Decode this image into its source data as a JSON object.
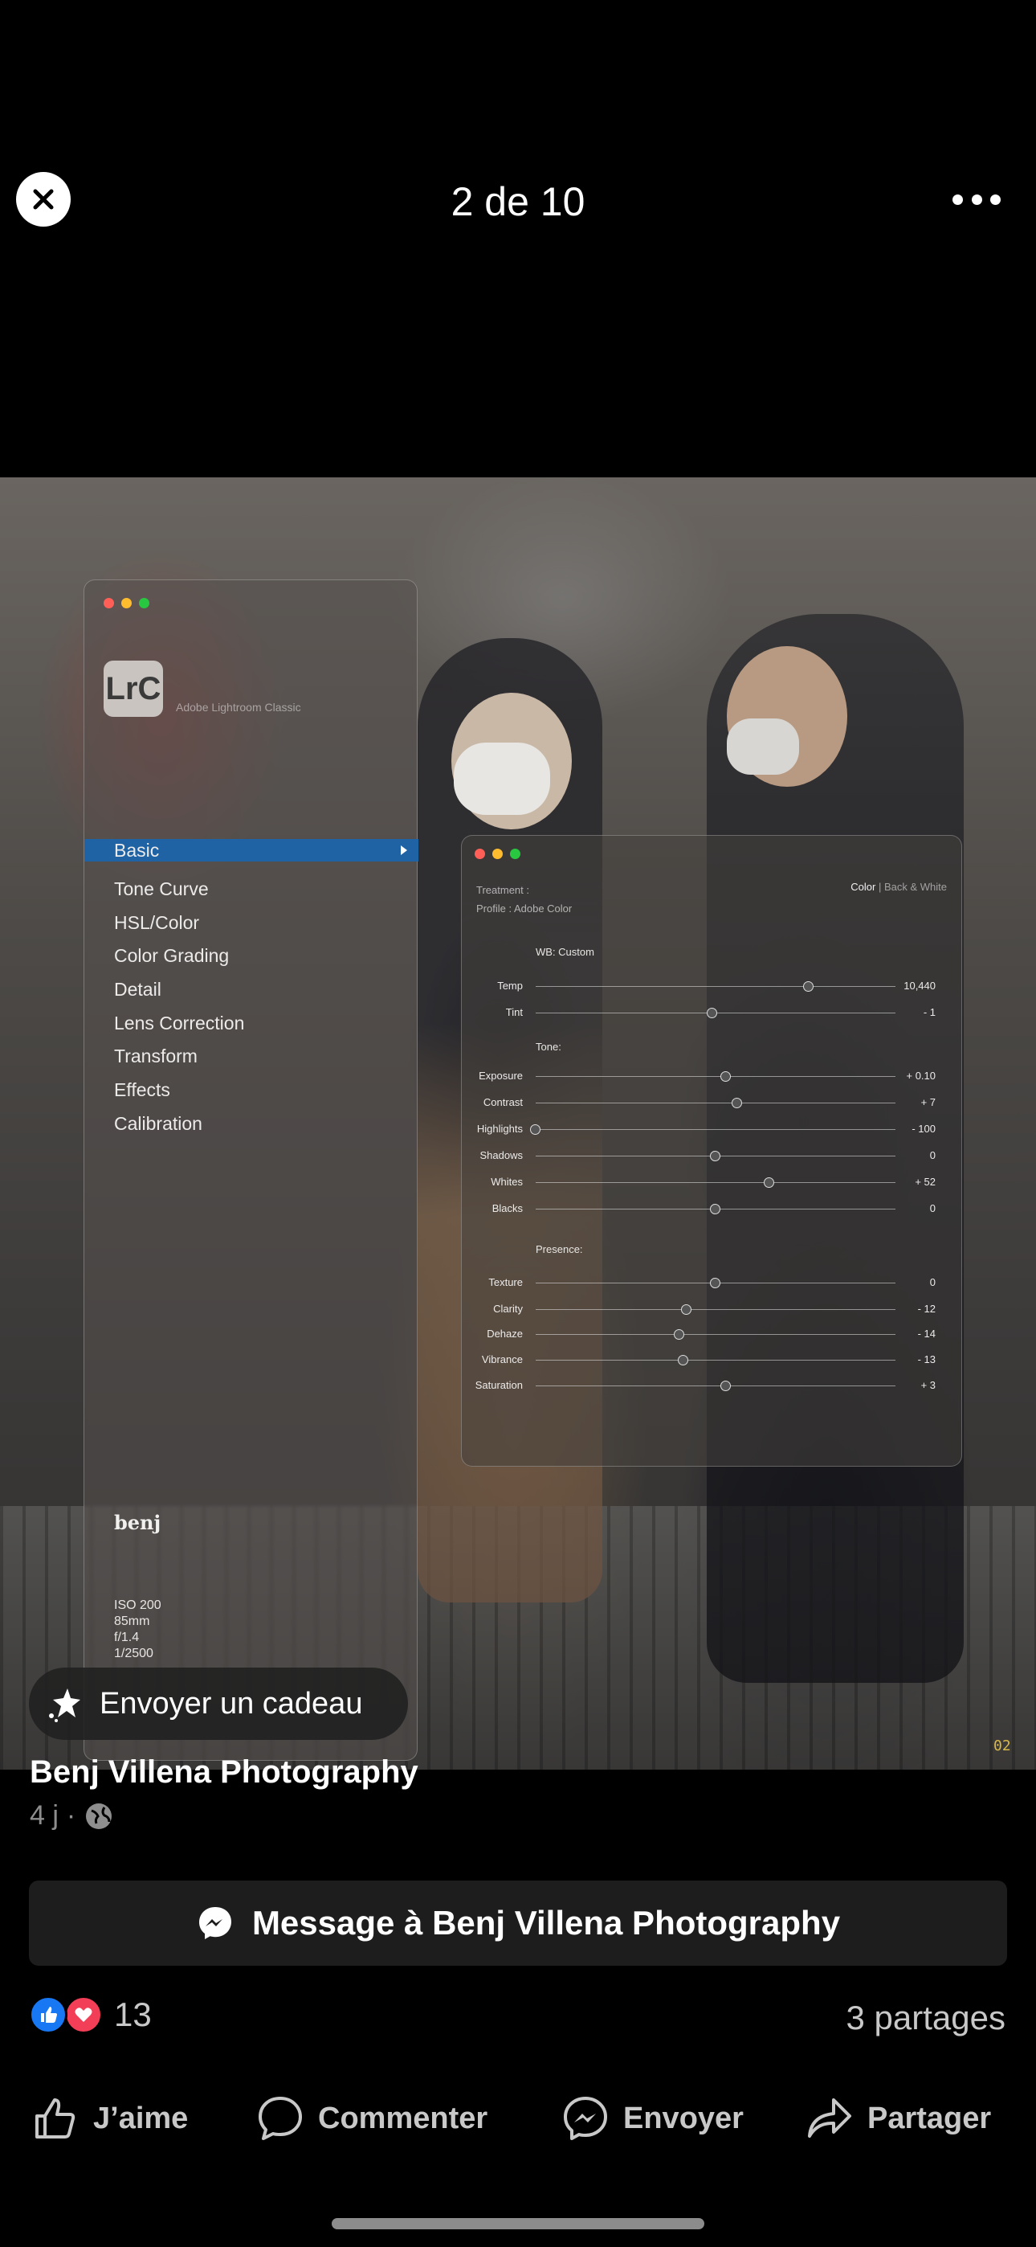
{
  "viewer": {
    "counter": "2 de 10",
    "close_icon": "close-icon",
    "more_icon": "more-horizontal-icon"
  },
  "lrc_panel": {
    "logo_text": "LrC",
    "app_name": "Adobe Lightroom Classic",
    "menu": [
      {
        "label": "Basic",
        "active": true
      },
      {
        "label": "Tone Curve"
      },
      {
        "label": "HSL/Color"
      },
      {
        "label": "Color Grading"
      },
      {
        "label": "Detail"
      },
      {
        "label": "Lens Correction"
      },
      {
        "label": "Transform"
      },
      {
        "label": "Effects"
      },
      {
        "label": "Calibration"
      }
    ],
    "brand": "benj",
    "exif": [
      "ISO 200",
      "85mm",
      "f/1.4",
      "1/2500"
    ]
  },
  "develop_panel": {
    "treatment_label": "Treatment :",
    "profile_label": "Profile : Adobe Color",
    "treatment_color": "Color",
    "treatment_sep": "|",
    "treatment_bw": "Back & White",
    "wb_section": "WB: Custom",
    "tone_section": "Tone:",
    "presence_section": "Presence:",
    "sliders": [
      {
        "label": "Temp",
        "value": "10,440",
        "position": 0.76
      },
      {
        "label": "Tint",
        "value": "- 1",
        "position": 0.49
      },
      {
        "label": "Exposure",
        "value": "+ 0.10",
        "position": 0.53
      },
      {
        "label": "Contrast",
        "value": "+ 7",
        "position": 0.56
      },
      {
        "label": "Highlights",
        "value": "- 100",
        "position": 0.0
      },
      {
        "label": "Shadows",
        "value": "0",
        "position": 0.5
      },
      {
        "label": "Whites",
        "value": "+ 52",
        "position": 0.65
      },
      {
        "label": "Blacks",
        "value": "0",
        "position": 0.5
      },
      {
        "label": "Texture",
        "value": "0",
        "position": 0.5
      },
      {
        "label": "Clarity",
        "value": "- 12",
        "position": 0.42
      },
      {
        "label": "Dehaze",
        "value": "- 14",
        "position": 0.4
      },
      {
        "label": "Vibrance",
        "value": "- 13",
        "position": 0.41
      },
      {
        "label": "Saturation",
        "value": "+ 3",
        "position": 0.53
      }
    ]
  },
  "photo_page_number": "02",
  "gift": {
    "label": "Envoyer un cadeau",
    "icon": "gift-sparkle-icon"
  },
  "post": {
    "author": "Benj Villena Photography",
    "age": "4 j",
    "separator": "·",
    "privacy_icon": "globe-icon"
  },
  "message_button": {
    "label": "Message à Benj Villena Photography",
    "icon": "messenger-icon"
  },
  "reactions": {
    "count": "13",
    "icons": [
      "like-reaction-icon",
      "love-reaction-icon"
    ]
  },
  "shares": "3 partages",
  "actions": [
    {
      "label": "J’aime",
      "icon": "thumbs-up-icon"
    },
    {
      "label": "Commenter",
      "icon": "comment-icon"
    },
    {
      "label": "Envoyer",
      "icon": "messenger-icon"
    },
    {
      "label": "Partager",
      "icon": "share-icon"
    }
  ],
  "colors": {
    "active_menu": "#1f63a5",
    "like_blue": "#1877f2",
    "love_red": "#f33e58",
    "page_num": "#d9b84a"
  }
}
